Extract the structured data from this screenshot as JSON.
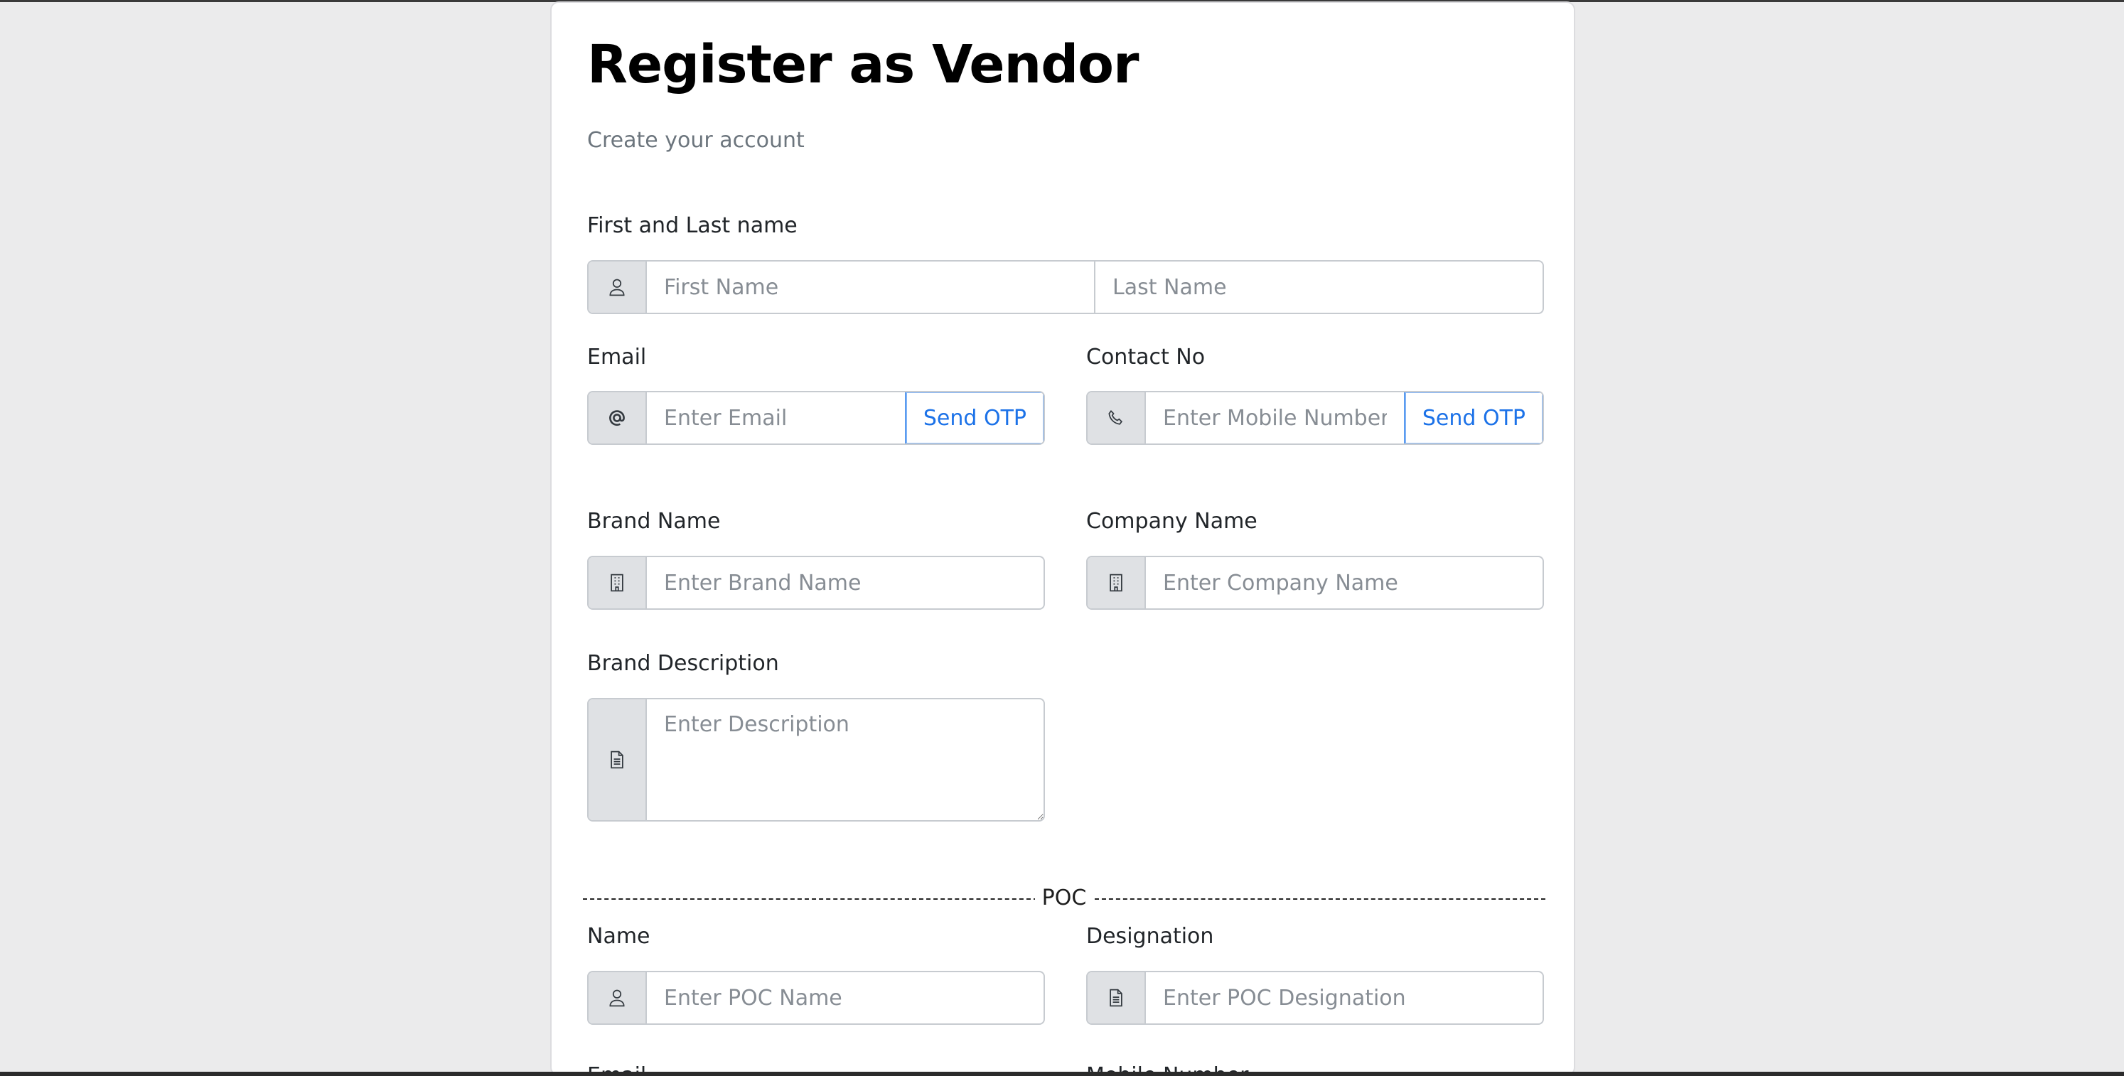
{
  "page": {
    "title": "Register as Vendor",
    "subtitle": "Create your account"
  },
  "name_section": {
    "label": "First and Last name",
    "first_placeholder": "First Name",
    "last_placeholder": "Last Name",
    "icon": "user-icon"
  },
  "email": {
    "label": "Email",
    "placeholder": "Enter Email",
    "otp_label": "Send OTP",
    "icon": "at-icon"
  },
  "contact": {
    "label": "Contact No",
    "placeholder": "Enter Mobile Number",
    "otp_label": "Send OTP",
    "icon": "phone-icon"
  },
  "brand": {
    "label": "Brand Name",
    "placeholder": "Enter Brand Name",
    "icon": "building-icon"
  },
  "company": {
    "label": "Company Name",
    "placeholder": "Enter Company Name",
    "icon": "building-icon"
  },
  "description": {
    "label": "Brand Description",
    "placeholder": "Enter Description",
    "icon": "document-icon"
  },
  "poc": {
    "section_label": "POC",
    "name_label": "Name",
    "name_placeholder": "Enter POC Name",
    "designation_label": "Designation",
    "designation_placeholder": "Enter POC Designation",
    "email_label": "Email",
    "mobile_label": "Mobile Number"
  },
  "colors": {
    "accent": "#1c72e8",
    "addon_bg": "#dfe1e4",
    "page_bg": "#ebebec"
  }
}
